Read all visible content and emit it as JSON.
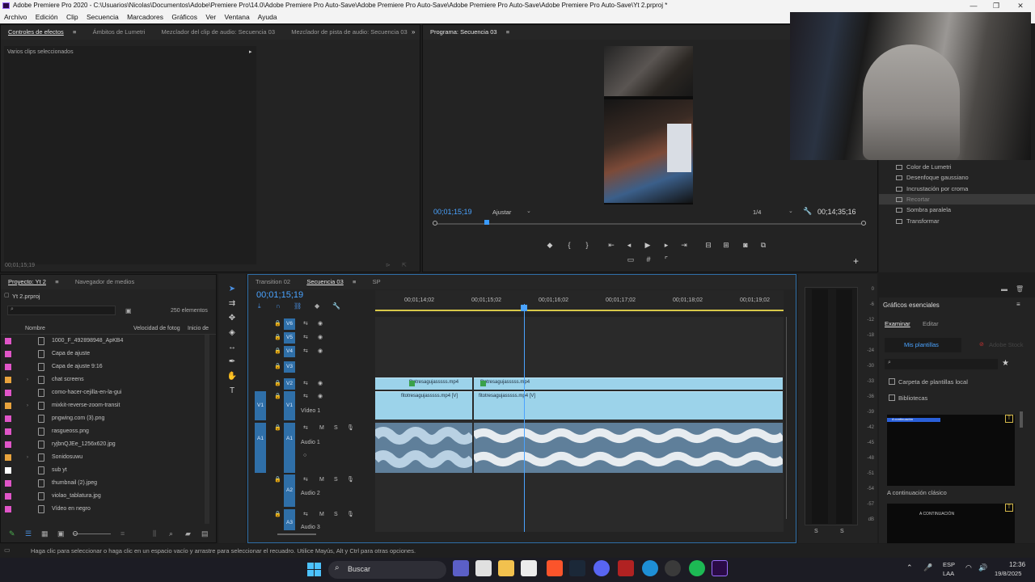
{
  "title_bar": {
    "text": "Adobe Premiere Pro 2020 - C:\\Usuarios\\Nicolas\\Documentos\\Adobe\\Premiere Pro\\14.0\\Adobe Premiere Pro Auto-Save\\Adobe Premiere Pro Auto-Save\\Adobe Premiere Pro Auto-Save\\Adobe Premiere Pro Auto-Save\\Yt 2.prproj *"
  },
  "menu": [
    "Archivo",
    "Edición",
    "Clip",
    "Secuencia",
    "Marcadores",
    "Gráficos",
    "Ver",
    "Ventana",
    "Ayuda"
  ],
  "source_panel": {
    "tabs": [
      "Controles de efectos",
      "Ámbitos de Lumetri",
      "Mezclador del clip de audio: Secuencia 03",
      "Mezclador de pista de audio: Secuencia 03"
    ],
    "subtitle": "Varios clips seleccionados",
    "timecode": "00;01;15;19"
  },
  "program": {
    "tab": "Programa: Secuencia 03",
    "timecode_left": "00;01;15;19",
    "fit": "Ajustar",
    "quality": "1/4",
    "timecode_right": "00;14;35;16",
    "playhead_pct": 0.12
  },
  "effects_list": [
    "Color de Lumetri",
    "Desenfoque gaussiano",
    "Incrustación por croma",
    "Recortar",
    "Sombra paralela",
    "Transformar"
  ],
  "effects_selected": "Recortar",
  "project": {
    "tabs": [
      "Proyecto: Yt 2",
      "Navegador de medios"
    ],
    "file": "Yt 2.prproj",
    "count": "250 elementos",
    "col_name": "Nombre",
    "col_speed": "Velocidad de fotog",
    "col_start": "Inicio de",
    "items": [
      {
        "name": "1000_F_492898948_ApKB4",
        "color": "#e055c8",
        "folder": false
      },
      {
        "name": "Capa de ajuste",
        "color": "#e055c8",
        "folder": false
      },
      {
        "name": "Capa de ajuste 9:16",
        "color": "#e055c8",
        "folder": false
      },
      {
        "name": "chat screens",
        "color": "#e8a33d",
        "folder": true
      },
      {
        "name": "como-hacer-cejilla-en-la-gui",
        "color": "#e055c8",
        "folder": false
      },
      {
        "name": "mixkit-reverse-zoom-transit",
        "color": "#e8a33d",
        "folder": true
      },
      {
        "name": "pngwing.com (3).png",
        "color": "#e055c8",
        "folder": false
      },
      {
        "name": "rasgueoss.png",
        "color": "#e055c8",
        "folder": false
      },
      {
        "name": "ryjbnQJEe_1256x620.jpg",
        "color": "#e055c8",
        "folder": false
      },
      {
        "name": "Sonidosuwu",
        "color": "#e8a33d",
        "folder": true
      },
      {
        "name": "sub yt",
        "color": "#ffffff",
        "folder": false
      },
      {
        "name": "thumbnail (2).jpeg",
        "color": "#e055c8",
        "folder": false
      },
      {
        "name": "violao_tablatura.jpg",
        "color": "#e055c8",
        "folder": false
      },
      {
        "name": "Vídeo en negro",
        "color": "#e055c8",
        "folder": false
      }
    ]
  },
  "timeline": {
    "tabs": [
      "Transition 02",
      "Secuencia 03",
      "SP"
    ],
    "timecode": "00;01;15;19",
    "ruler": [
      "00;01;14;02",
      "00;01;15;02",
      "00;01;16;02",
      "00;01;17;02",
      "00;01;18;02",
      "00;01;19;02"
    ],
    "tracks_video": [
      "V6",
      "V5",
      "V4",
      "V3",
      "V2",
      "V1"
    ],
    "video1_label": "Vídeo 1",
    "audio1_label": "Audio 1",
    "audio2_label": "Audio 2",
    "audio3_label": "Audio 3",
    "clip_v2_a": "fitotresagujasssss.mp4",
    "clip_v2_b": "fitotresagujasssss.mp4",
    "clip_v1_a": "fitotresagujasssss.mp4 [V]",
    "clip_v1_b": "fitotresagujasssss.mp4 [V]"
  },
  "meter_db": [
    "0",
    "-6",
    "-12",
    "-18",
    "-24",
    "-30",
    "-33",
    "-36",
    "-39",
    "-42",
    "-45",
    "-48",
    "-51",
    "-54",
    "-57",
    "dB"
  ],
  "meter_s": "S",
  "graphics": {
    "title": "Gráficos esenciales",
    "tabs": [
      "Examinar",
      "Editar"
    ],
    "my_templates": "Mis plantillas",
    "adobe_stock": "Adobe Stock",
    "local_folder": "Carpeta de plantillas local",
    "libraries": "Bibliotecas",
    "template1_name": "A continuación clásico",
    "template1_text": "A continuación",
    "template2_text": "A CONTINUACIÓN"
  },
  "status": "Haga clic para seleccionar o haga clic en un espacio vacío y arrastre para seleccionar el recuadro. Utilice Mayús, Alt y Ctrl para otras opciones.",
  "taskbar": {
    "search": "Buscar",
    "lang1": "ESP",
    "lang2": "LAA",
    "time": "12:36",
    "date": "19/8/2025"
  }
}
